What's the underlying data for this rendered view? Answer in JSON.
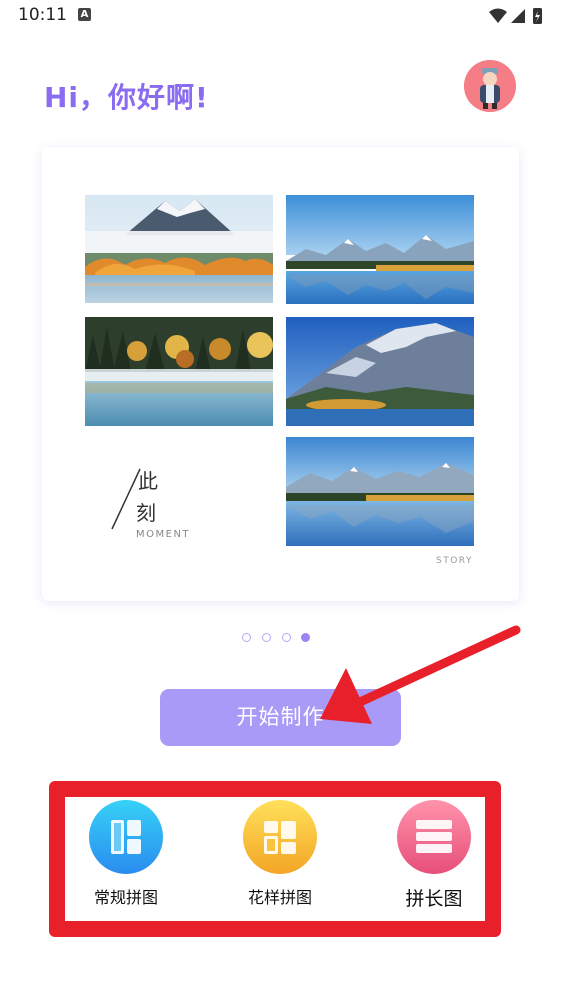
{
  "status_bar": {
    "time": "10:11",
    "notification_icon": "a-icon",
    "icons": [
      "wifi-icon",
      "signal-icon",
      "battery-icon"
    ]
  },
  "header": {
    "greeting": "Hi，你好啊!",
    "avatar_icon": "avatar-icon"
  },
  "carousel": {
    "moment_text_1": "此",
    "moment_text_2": "刻",
    "moment_english": "MOMENT",
    "story_text": "STORY",
    "page_count": 4,
    "active_page": 4
  },
  "start_button": {
    "label": "开始制作"
  },
  "tools": [
    {
      "label": "常规拼图",
      "icon": "grid-collage-icon",
      "color_from": "#2fc7f5",
      "color_to": "#2b8ff0"
    },
    {
      "label": "花样拼图",
      "icon": "pattern-collage-icon",
      "color_from": "#ffd84a",
      "color_to": "#f5a623"
    },
    {
      "label": "拼长图",
      "icon": "long-collage-icon",
      "color_from": "#ff8ea8",
      "color_to": "#e8507a"
    }
  ],
  "colors": {
    "accent": "#8a6cf0",
    "button": "#a89af6",
    "annotation_red": "#e8202a"
  }
}
